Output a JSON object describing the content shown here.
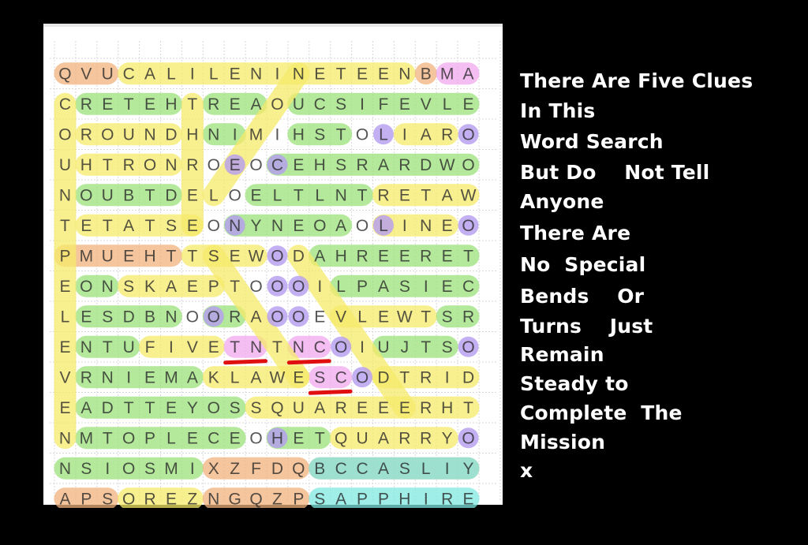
{
  "puzzle": {
    "rows": [
      "QVUCALILENINETEENBMA",
      "CRETEHTREAOUCSIFEVLE",
      "OROUNDHNIMIHSTOLIARO",
      "UHTRONROEOCEHSRARDWO",
      "NOUBTDELOELTLNTRETAW",
      "TETATSEONYNEOAOLINEO",
      "PMUEHTTSEWODAHREERET",
      "EONSKAEPTOOOILPASIEC",
      "LESDBNOORAOOEVLEWTSR",
      "ENTUFIVETNTNCOIUJTSO",
      "VRNIEMAKLAWESCODTRID",
      "EADTTEYOSSQUAREEERHT",
      "NMTOPLECEOHETQUARRYO",
      "NSIOSMIXZFDQBCCASLIY",
      "APSOREZNGQZPSAPPHIRE"
    ],
    "highlight_colors": {
      "yellow": "#f5ea6a",
      "green": "#9be27a",
      "orange": "#f2b27c",
      "purple": "#b49cf0",
      "pink": "#f2a8ee",
      "cyan": "#7fe8e0",
      "red": "#e01010"
    },
    "highlights": [
      {
        "color": "orange",
        "from": [
          0,
          0
        ],
        "to": [
          0,
          2
        ]
      },
      {
        "color": "yellow",
        "from": [
          0,
          3
        ],
        "to": [
          0,
          16
        ]
      },
      {
        "color": "orange",
        "from": [
          0,
          17
        ],
        "to": [
          0,
          17
        ]
      },
      {
        "color": "pink",
        "from": [
          0,
          18
        ],
        "to": [
          0,
          19
        ]
      },
      {
        "color": "green",
        "from": [
          1,
          1
        ],
        "to": [
          1,
          5
        ]
      },
      {
        "color": "green",
        "from": [
          1,
          7
        ],
        "to": [
          1,
          9
        ]
      },
      {
        "color": "green",
        "from": [
          1,
          11
        ],
        "to": [
          1,
          19
        ]
      },
      {
        "color": "yellow",
        "from": [
          2,
          1
        ],
        "to": [
          2,
          5
        ]
      },
      {
        "color": "green",
        "from": [
          2,
          7
        ],
        "to": [
          2,
          8
        ]
      },
      {
        "color": "green",
        "from": [
          2,
          11
        ],
        "to": [
          2,
          13
        ]
      },
      {
        "color": "yellow",
        "from": [
          2,
          16
        ],
        "to": [
          2,
          18
        ]
      },
      {
        "color": "yellow",
        "from": [
          3,
          1
        ],
        "to": [
          3,
          5
        ]
      },
      {
        "color": "green",
        "from": [
          3,
          10
        ],
        "to": [
          3,
          19
        ]
      },
      {
        "color": "green",
        "from": [
          4,
          1
        ],
        "to": [
          4,
          5
        ]
      },
      {
        "color": "green",
        "from": [
          4,
          9
        ],
        "to": [
          4,
          14
        ]
      },
      {
        "color": "yellow",
        "from": [
          4,
          15
        ],
        "to": [
          4,
          19
        ]
      },
      {
        "color": "yellow",
        "from": [
          5,
          1
        ],
        "to": [
          5,
          6
        ]
      },
      {
        "color": "green",
        "from": [
          5,
          8
        ],
        "to": [
          5,
          13
        ]
      },
      {
        "color": "yellow",
        "from": [
          5,
          15
        ],
        "to": [
          5,
          18
        ]
      },
      {
        "color": "orange",
        "from": [
          6,
          0
        ],
        "to": [
          6,
          5
        ]
      },
      {
        "color": "yellow",
        "from": [
          6,
          6
        ],
        "to": [
          6,
          9
        ]
      },
      {
        "color": "green",
        "from": [
          6,
          12
        ],
        "to": [
          6,
          19
        ]
      },
      {
        "color": "green",
        "from": [
          7,
          1
        ],
        "to": [
          7,
          2
        ]
      },
      {
        "color": "yellow",
        "from": [
          7,
          3
        ],
        "to": [
          7,
          7
        ]
      },
      {
        "color": "green",
        "from": [
          7,
          13
        ],
        "to": [
          7,
          19
        ]
      },
      {
        "color": "green",
        "from": [
          8,
          1
        ],
        "to": [
          8,
          5
        ]
      },
      {
        "color": "green",
        "from": [
          8,
          7
        ],
        "to": [
          8,
          8
        ]
      },
      {
        "color": "yellow",
        "from": [
          8,
          13
        ],
        "to": [
          8,
          17
        ]
      },
      {
        "color": "green",
        "from": [
          8,
          18
        ],
        "to": [
          8,
          19
        ]
      },
      {
        "color": "green",
        "from": [
          9,
          1
        ],
        "to": [
          9,
          3
        ]
      },
      {
        "color": "yellow",
        "from": [
          9,
          4
        ],
        "to": [
          9,
          7
        ]
      },
      {
        "color": "green",
        "from": [
          9,
          15
        ],
        "to": [
          9,
          18
        ]
      },
      {
        "color": "pink",
        "from": [
          9,
          8
        ],
        "to": [
          9,
          9
        ]
      },
      {
        "color": "pink",
        "from": [
          9,
          11
        ],
        "to": [
          9,
          12
        ]
      },
      {
        "color": "green",
        "from": [
          10,
          1
        ],
        "to": [
          10,
          6
        ]
      },
      {
        "color": "yellow",
        "from": [
          10,
          7
        ],
        "to": [
          10,
          11
        ]
      },
      {
        "color": "pink",
        "from": [
          10,
          12
        ],
        "to": [
          10,
          13
        ]
      },
      {
        "color": "yellow",
        "from": [
          10,
          15
        ],
        "to": [
          10,
          19
        ]
      },
      {
        "color": "green",
        "from": [
          11,
          1
        ],
        "to": [
          11,
          8
        ]
      },
      {
        "color": "yellow",
        "from": [
          11,
          9
        ],
        "to": [
          11,
          19
        ]
      },
      {
        "color": "green",
        "from": [
          12,
          1
        ],
        "to": [
          12,
          8
        ]
      },
      {
        "color": "green",
        "from": [
          12,
          10
        ],
        "to": [
          12,
          12
        ]
      },
      {
        "color": "yellow",
        "from": [
          12,
          13
        ],
        "to": [
          12,
          18
        ]
      },
      {
        "color": "green",
        "from": [
          13,
          0
        ],
        "to": [
          13,
          6
        ]
      },
      {
        "color": "orange",
        "from": [
          13,
          7
        ],
        "to": [
          13,
          11
        ]
      },
      {
        "color": "orange",
        "from": [
          13,
          12
        ],
        "to": [
          13,
          19
        ]
      },
      {
        "color": "cyan",
        "from": [
          13,
          12
        ],
        "to": [
          13,
          19
        ]
      },
      {
        "color": "orange",
        "from": [
          14,
          0
        ],
        "to": [
          14,
          2
        ]
      },
      {
        "color": "yellow",
        "from": [
          14,
          3
        ],
        "to": [
          14,
          6
        ]
      },
      {
        "color": "orange",
        "from": [
          14,
          7
        ],
        "to": [
          14,
          11
        ]
      },
      {
        "color": "cyan",
        "from": [
          14,
          12
        ],
        "to": [
          14,
          19
        ]
      },
      {
        "color": "yellow",
        "from": [
          1,
          0
        ],
        "to": [
          12,
          0
        ]
      },
      {
        "color": "yellow",
        "from": [
          1,
          6
        ],
        "to": [
          5,
          6
        ]
      },
      {
        "color": "yellow",
        "from": [
          0,
          11
        ],
        "to": [
          4,
          7
        ]
      },
      {
        "color": "yellow",
        "from": [
          6,
          7
        ],
        "to": [
          10,
          11
        ]
      },
      {
        "color": "yellow",
        "from": [
          6,
          11
        ],
        "to": [
          11,
          16
        ]
      }
    ],
    "circles": [
      [
        3,
        8
      ],
      [
        3,
        10
      ],
      [
        2,
        15
      ],
      [
        2,
        19
      ],
      [
        5,
        8
      ],
      [
        5,
        15
      ],
      [
        5,
        19
      ],
      [
        7,
        10
      ],
      [
        7,
        11
      ],
      [
        8,
        7
      ],
      [
        8,
        10
      ],
      [
        8,
        11
      ],
      [
        9,
        13
      ],
      [
        9,
        19
      ],
      [
        10,
        14
      ],
      [
        12,
        10
      ],
      [
        12,
        19
      ],
      [
        6,
        10
      ]
    ],
    "underlines": [
      {
        "row": 9,
        "from": 8,
        "to": 9
      },
      {
        "row": 9,
        "from": 11,
        "to": 12
      },
      {
        "row": 10,
        "from": 12,
        "to": 13
      }
    ]
  },
  "clues": {
    "lines": [
      "There Are Five Clues",
      "In This",
      "Word Search",
      "But Do    Not Tell",
      "Anyone",
      "There Are",
      "No  Special",
      "Bends    Or",
      "Turns    Just",
      "Remain",
      "Steady to",
      "Complete  The",
      "Mission",
      "x"
    ]
  }
}
